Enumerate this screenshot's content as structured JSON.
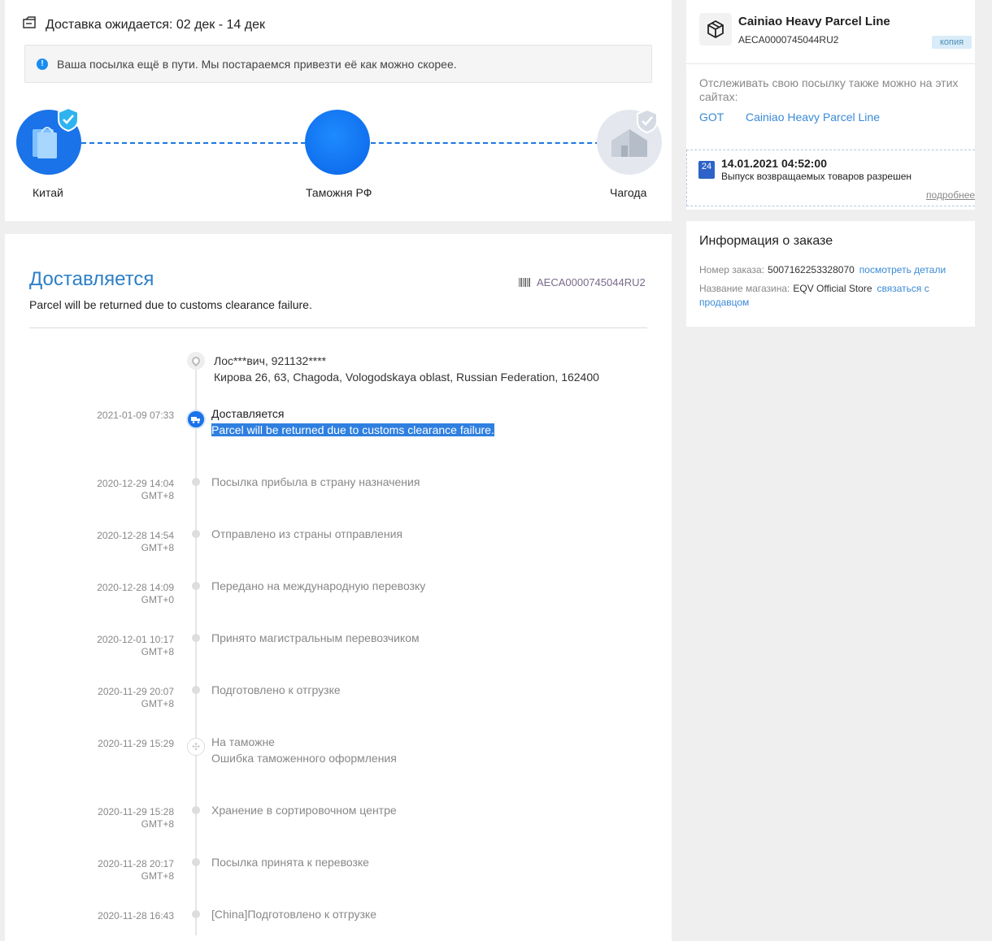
{
  "delivery": {
    "expected_label": "Доставка ожидается: 02 дек - 14 дек",
    "notice": "Ваша посылка ещё в пути. Мы постараемся привезти её как можно скорее.",
    "route": [
      {
        "label": "Китай"
      },
      {
        "label": "Таможня РФ"
      },
      {
        "label": "Чагода"
      }
    ]
  },
  "tracking": {
    "status_title": "Доставляется",
    "status_subtitle": "Parcel will be returned due to customs clearance failure.",
    "tracking_number": "AECA0000745044RU2",
    "address_line1": "Лос***вич,  921132****",
    "address_line2": "Кирова 26, 63,  Chagoda,  Vologodskaya oblast,  Russian Federation,  162400",
    "events": [
      {
        "date": "2021-01-09 07:33",
        "tz": "",
        "title": "Доставляется",
        "detail": "Parcel will be returned due to customs clearance failure."
      },
      {
        "date": "2020-12-29 14:04",
        "tz": "GMT+8",
        "title": "Посылка прибыла в страну назначения",
        "detail": ""
      },
      {
        "date": "2020-12-28 14:54",
        "tz": "GMT+8",
        "title": "Отправлено из страны отправления",
        "detail": ""
      },
      {
        "date": "2020-12-28 14:09",
        "tz": "GMT+0",
        "title": "Передано на международную перевозку",
        "detail": ""
      },
      {
        "date": "2020-12-01 10:17",
        "tz": "GMT+8",
        "title": "Принято магистральным перевозчиком",
        "detail": ""
      },
      {
        "date": "2020-11-29 20:07",
        "tz": "GMT+8",
        "title": "Подготовлено к отгрузке",
        "detail": ""
      },
      {
        "date": "2020-11-29 15:29",
        "tz": "",
        "title": "На таможне",
        "detail": "Ошибка таможенного оформления"
      },
      {
        "date": "2020-11-29 15:28",
        "tz": "GMT+8",
        "title": "Хранение в сортировочном центре",
        "detail": ""
      },
      {
        "date": "2020-11-28 20:17",
        "tz": "GMT+8",
        "title": "Посылка принята к перевозке",
        "detail": ""
      },
      {
        "date": "2020-11-28 16:43",
        "tz": "",
        "title": "[China]Подготовлено к отгрузке",
        "detail": ""
      }
    ]
  },
  "carrier": {
    "name": "Cainiao Heavy Parcel Line",
    "code": "AECA0000745044RU2",
    "copy_label": "копия",
    "also_text": "Отслеживать свою посылку также можно на этих сайтах:",
    "sites": [
      "GOT",
      "Cainiao Heavy Parcel Line"
    ],
    "notice_icon_text": "24",
    "notice_time": "14.01.2021 04:52:00",
    "notice_message": "Выпуск возвращаемых товаров разрешен",
    "more_label": "подробнее"
  },
  "order": {
    "title": "Информация о заказе",
    "number_label": "Номер заказа:",
    "number_value": "5007162253328070",
    "number_link": "посмотреть детали",
    "store_label": "Название магазина:",
    "store_value": "EQV Official Store",
    "store_link": "связаться с продавцом"
  }
}
